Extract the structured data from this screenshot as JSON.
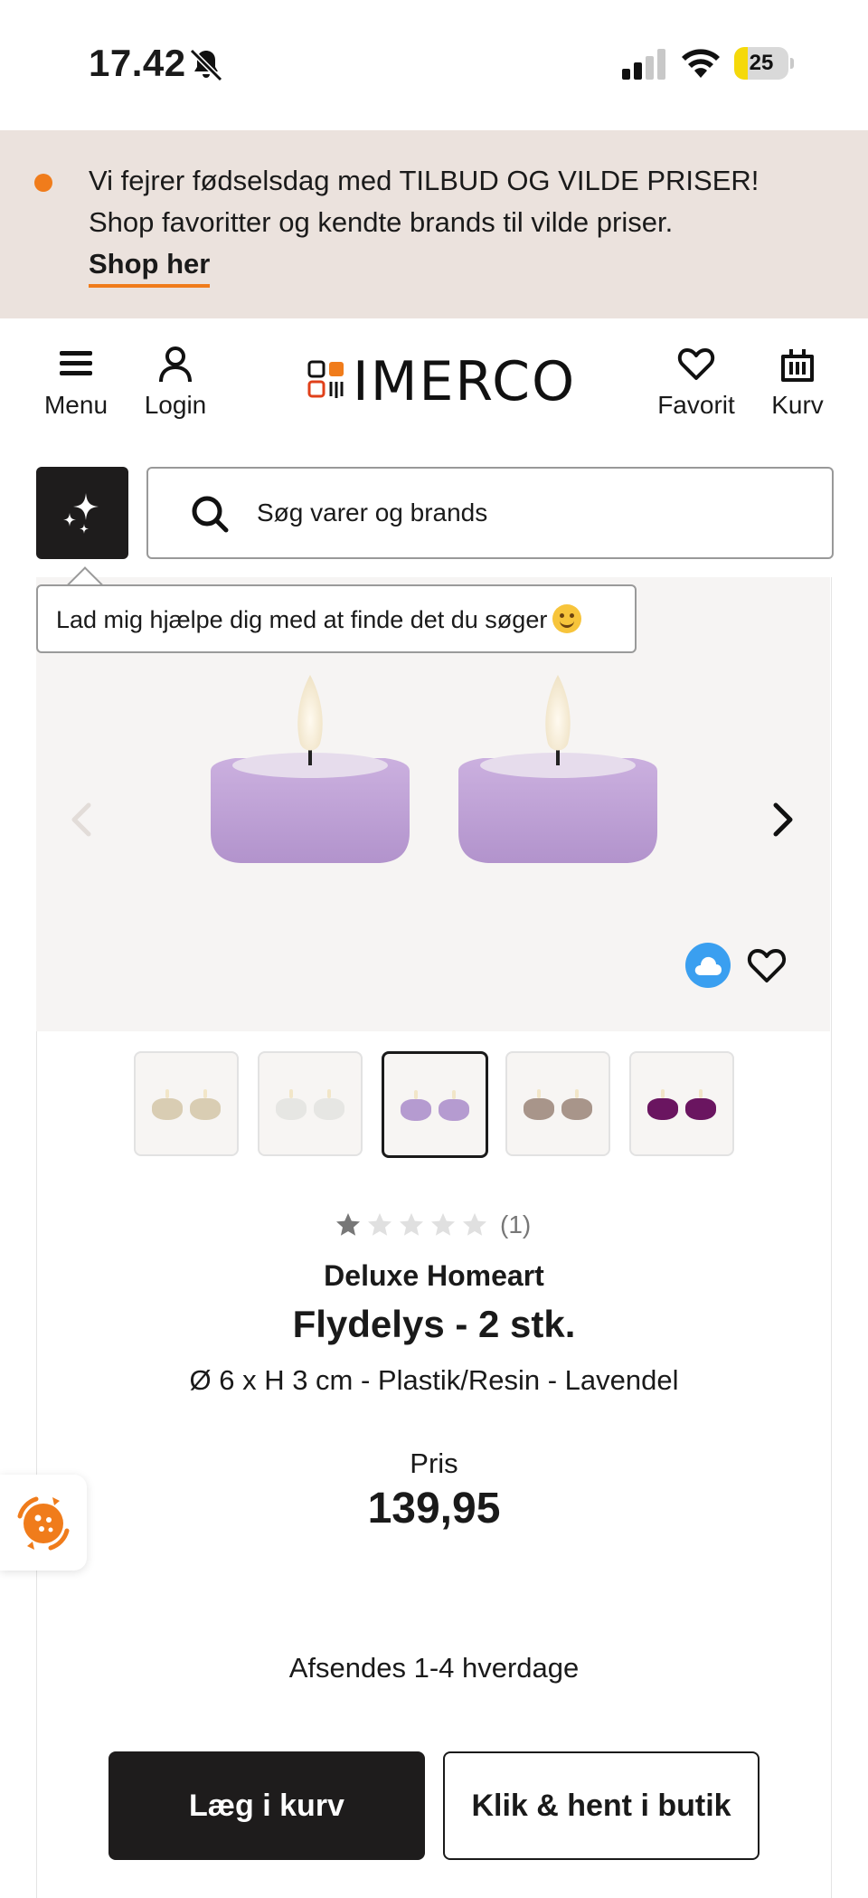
{
  "status_bar": {
    "time": "17.42",
    "battery": "25",
    "battery_level": 0.25,
    "icons": [
      "bell-slash-icon",
      "cellular-signal-icon",
      "wifi-icon",
      "battery-icon"
    ]
  },
  "promo": {
    "line1": "Vi fejrer fødselsdag med TILBUD OG VILDE PRISER!",
    "line2": "Shop favoritter og kendte brands til vilde priser.",
    "link": "Shop her",
    "accent_color": "#f07c1b"
  },
  "header": {
    "menu_label": "Menu",
    "login_label": "Login",
    "logo_text": "IMERCO",
    "favorites_label": "Favorit",
    "cart_label": "Kurv"
  },
  "search": {
    "placeholder": "Søg varer og brands"
  },
  "tooltip": {
    "text": "Lad mig hjælpe dig med at finde det du søger"
  },
  "product": {
    "rating": 1,
    "rating_max": 5,
    "review_count": "(1)",
    "brand": "Deluxe Homeart",
    "title": "Flydelys - 2 stk.",
    "spec": "Ø 6 x H 3 cm - Plastik/Resin - Lavendel",
    "price_label": "Pris",
    "price": "139,95",
    "shipping": "Afsendes 1-4 hverdage",
    "variant_colors": [
      "#d9cdb3",
      "#e6e6e3",
      "#b59bd0",
      "#a8958a",
      "#6a1560"
    ],
    "selected_variant": 2
  },
  "buttons": {
    "add_to_cart": "Læg i kurv",
    "click_collect": "Klik & hent i butik"
  },
  "colors": {
    "dark": "#1e1c1c",
    "promo_bg": "#ebe2dd",
    "candle": "#c5a6d9"
  }
}
